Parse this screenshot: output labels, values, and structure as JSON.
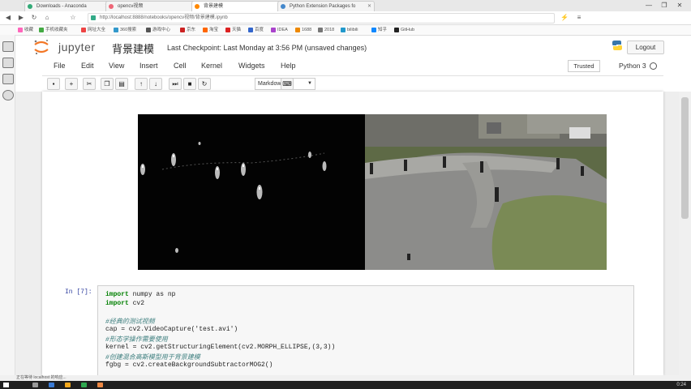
{
  "browser": {
    "tabs": [
      {
        "label": "Downloads - Anaconda",
        "active": false
      },
      {
        "label": "opencv视频",
        "active": false
      },
      {
        "label": "背景建模",
        "active": true
      },
      {
        "label": "Python Extension Packages fo",
        "active": false
      }
    ],
    "window_buttons": [
      "—",
      "❐",
      "✕"
    ],
    "url": "http://localhost:8888/notebooks/opencv视频/背景建模.ipynb",
    "bookmarks": [
      "收藏",
      "手机收藏夹",
      "网址大全",
      "360搜索",
      "游戏中心",
      "京东",
      "淘宝",
      "天猫",
      "百度",
      "IDEA",
      "1688",
      "2018",
      "bilibili",
      "知乎",
      "GitHub"
    ]
  },
  "jupyter": {
    "brand": "jupyter",
    "notebook_name": "背景建模",
    "checkpoint": "Last Checkpoint: Last Monday at 3:56 PM (unsaved changes)",
    "logout": "Logout",
    "menu": [
      "File",
      "Edit",
      "View",
      "Insert",
      "Cell",
      "Kernel",
      "Widgets",
      "Help"
    ],
    "trusted": "Trusted",
    "kernel_name": "Python 3",
    "toolbar_buttons": [
      "save-icon",
      "add-cell-icon",
      "cut-icon",
      "copy-icon",
      "paste-icon",
      "move-up-icon",
      "move-down-icon",
      "run-icon",
      "interrupt-icon",
      "restart-icon"
    ],
    "cell_type": "Markdown",
    "keyboard_icon": "keyboard-icon"
  },
  "cell": {
    "prompt": "In [7]:",
    "lines": [
      {
        "kind": "import",
        "kw": "import",
        "rest": " numpy as np"
      },
      {
        "kind": "import",
        "kw": "import",
        "rest": " cv2"
      },
      {
        "kind": "blank",
        "text": ""
      },
      {
        "kind": "comment",
        "text": "#经典的测试视频"
      },
      {
        "kind": "code",
        "text": "cap = cv2.VideoCapture('test.avi')"
      },
      {
        "kind": "comment",
        "text": "#形态学操作需要使用"
      },
      {
        "kind": "code",
        "text": "kernel = cv2.getStructuringElement(cv2.MORPH_ELLIPSE,(3,3))"
      },
      {
        "kind": "comment",
        "text": "#创建混合高斯模型用于背景建模"
      },
      {
        "kind": "code",
        "text": "fgbg = cv2.createBackgroundSubtractorMOG2()"
      }
    ]
  },
  "status_bar": "正在等待 localhost 的响应...",
  "taskbar": {
    "time": "0:24"
  }
}
